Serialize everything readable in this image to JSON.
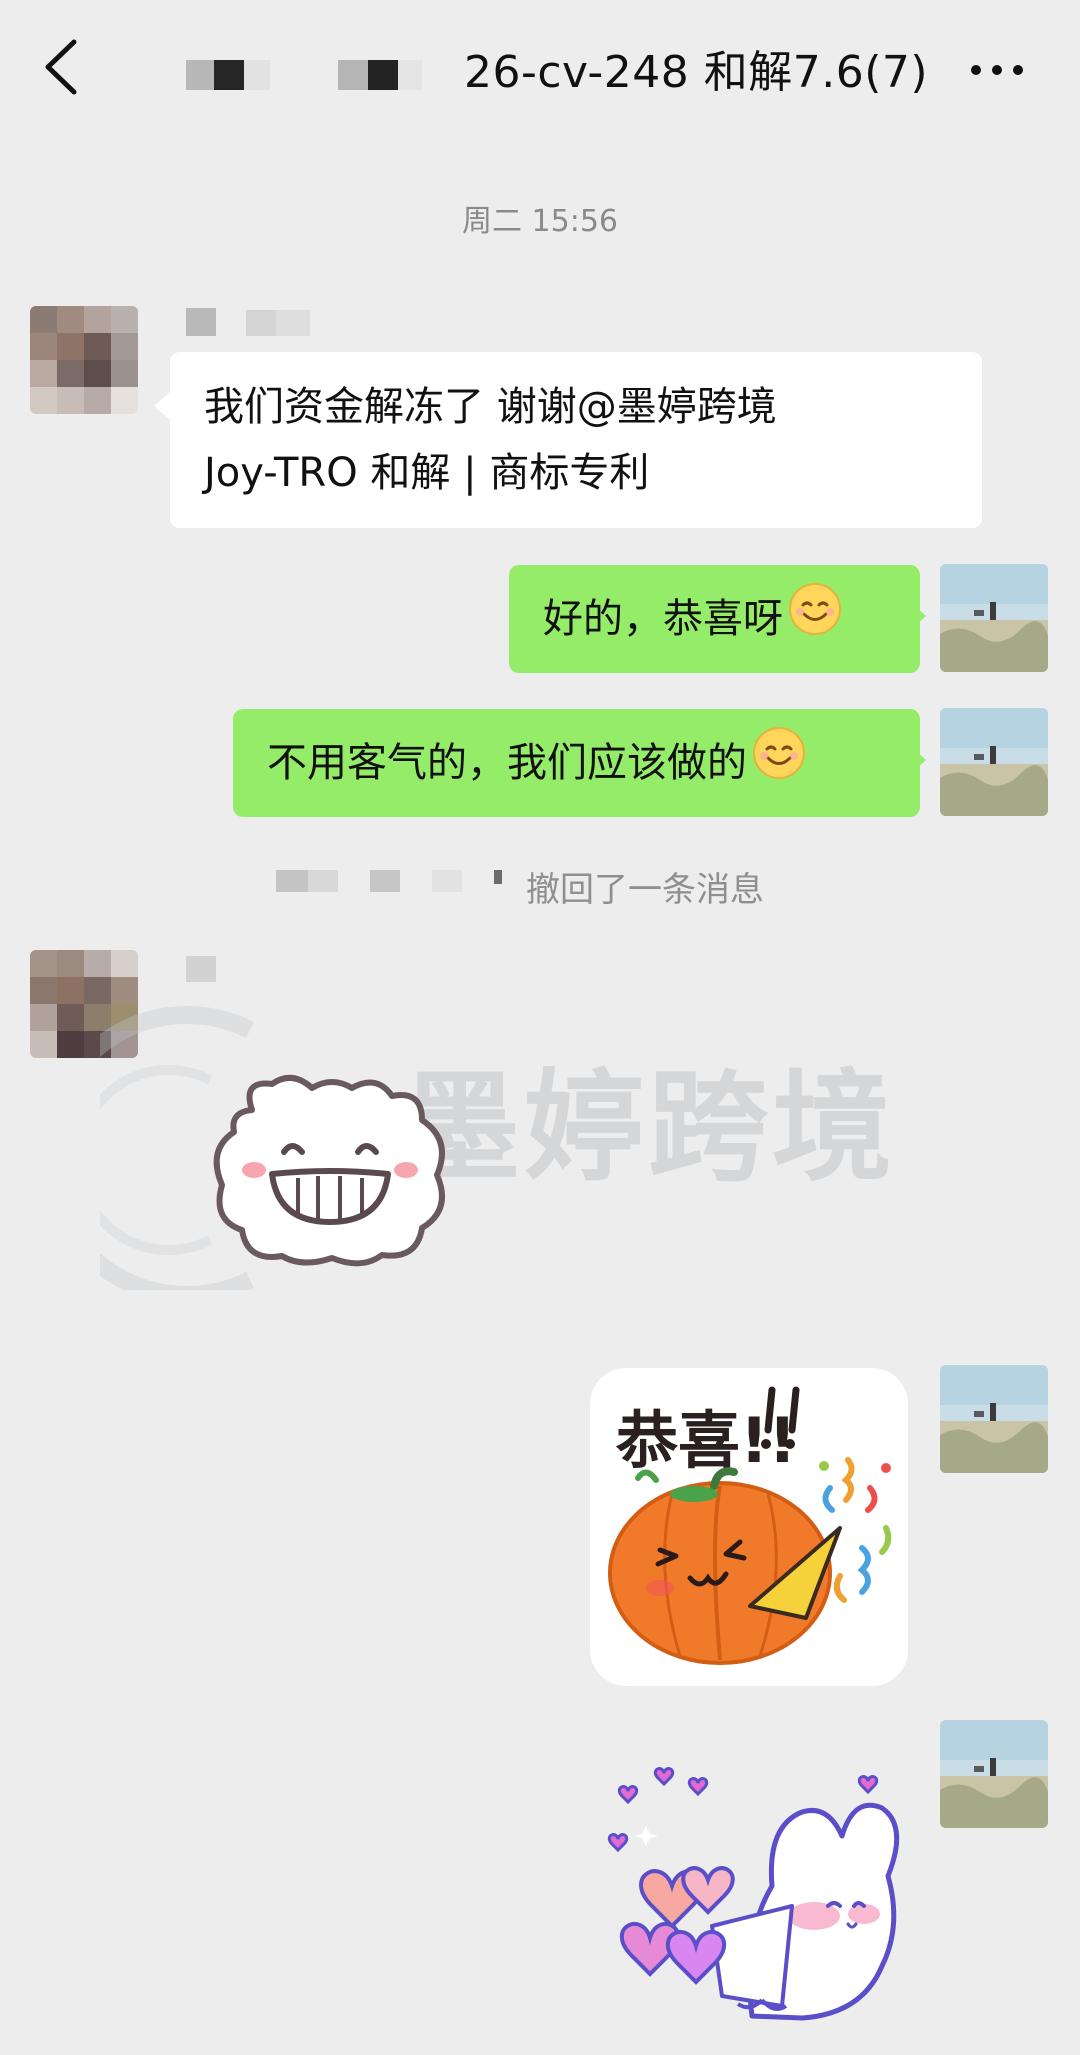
{
  "header": {
    "title": "26-cv-248 和解7.6(7)",
    "back_icon": "chevron-left-icon",
    "more_icon": "more-dots-icon"
  },
  "chat": {
    "timestamp": "周二 15:56",
    "messages": [
      {
        "side": "in",
        "text_line1": "我们资金解冻了 谢谢@墨婷跨境",
        "text_line2": "Joy-TRO 和解 | 商标专利"
      },
      {
        "side": "out",
        "text": "好的，恭喜呀",
        "emoji": "smile-emoji"
      },
      {
        "side": "out",
        "text": "不用客气的，我们应该做的",
        "emoji": "smile-emoji"
      }
    ],
    "recall_notice": "撤回了一条消息",
    "stickers": [
      {
        "side": "in",
        "name": "grinning-bear-sticker"
      },
      {
        "side": "out",
        "name": "pumpkin-congrats-sticker",
        "text": "恭喜!!"
      },
      {
        "side": "out",
        "name": "bunny-hearts-sticker"
      }
    ]
  },
  "watermark": {
    "text": "墨婷跨境"
  },
  "colors": {
    "background": "#ededed",
    "outgoing_bubble": "#95ec69",
    "incoming_bubble": "#ffffff"
  }
}
